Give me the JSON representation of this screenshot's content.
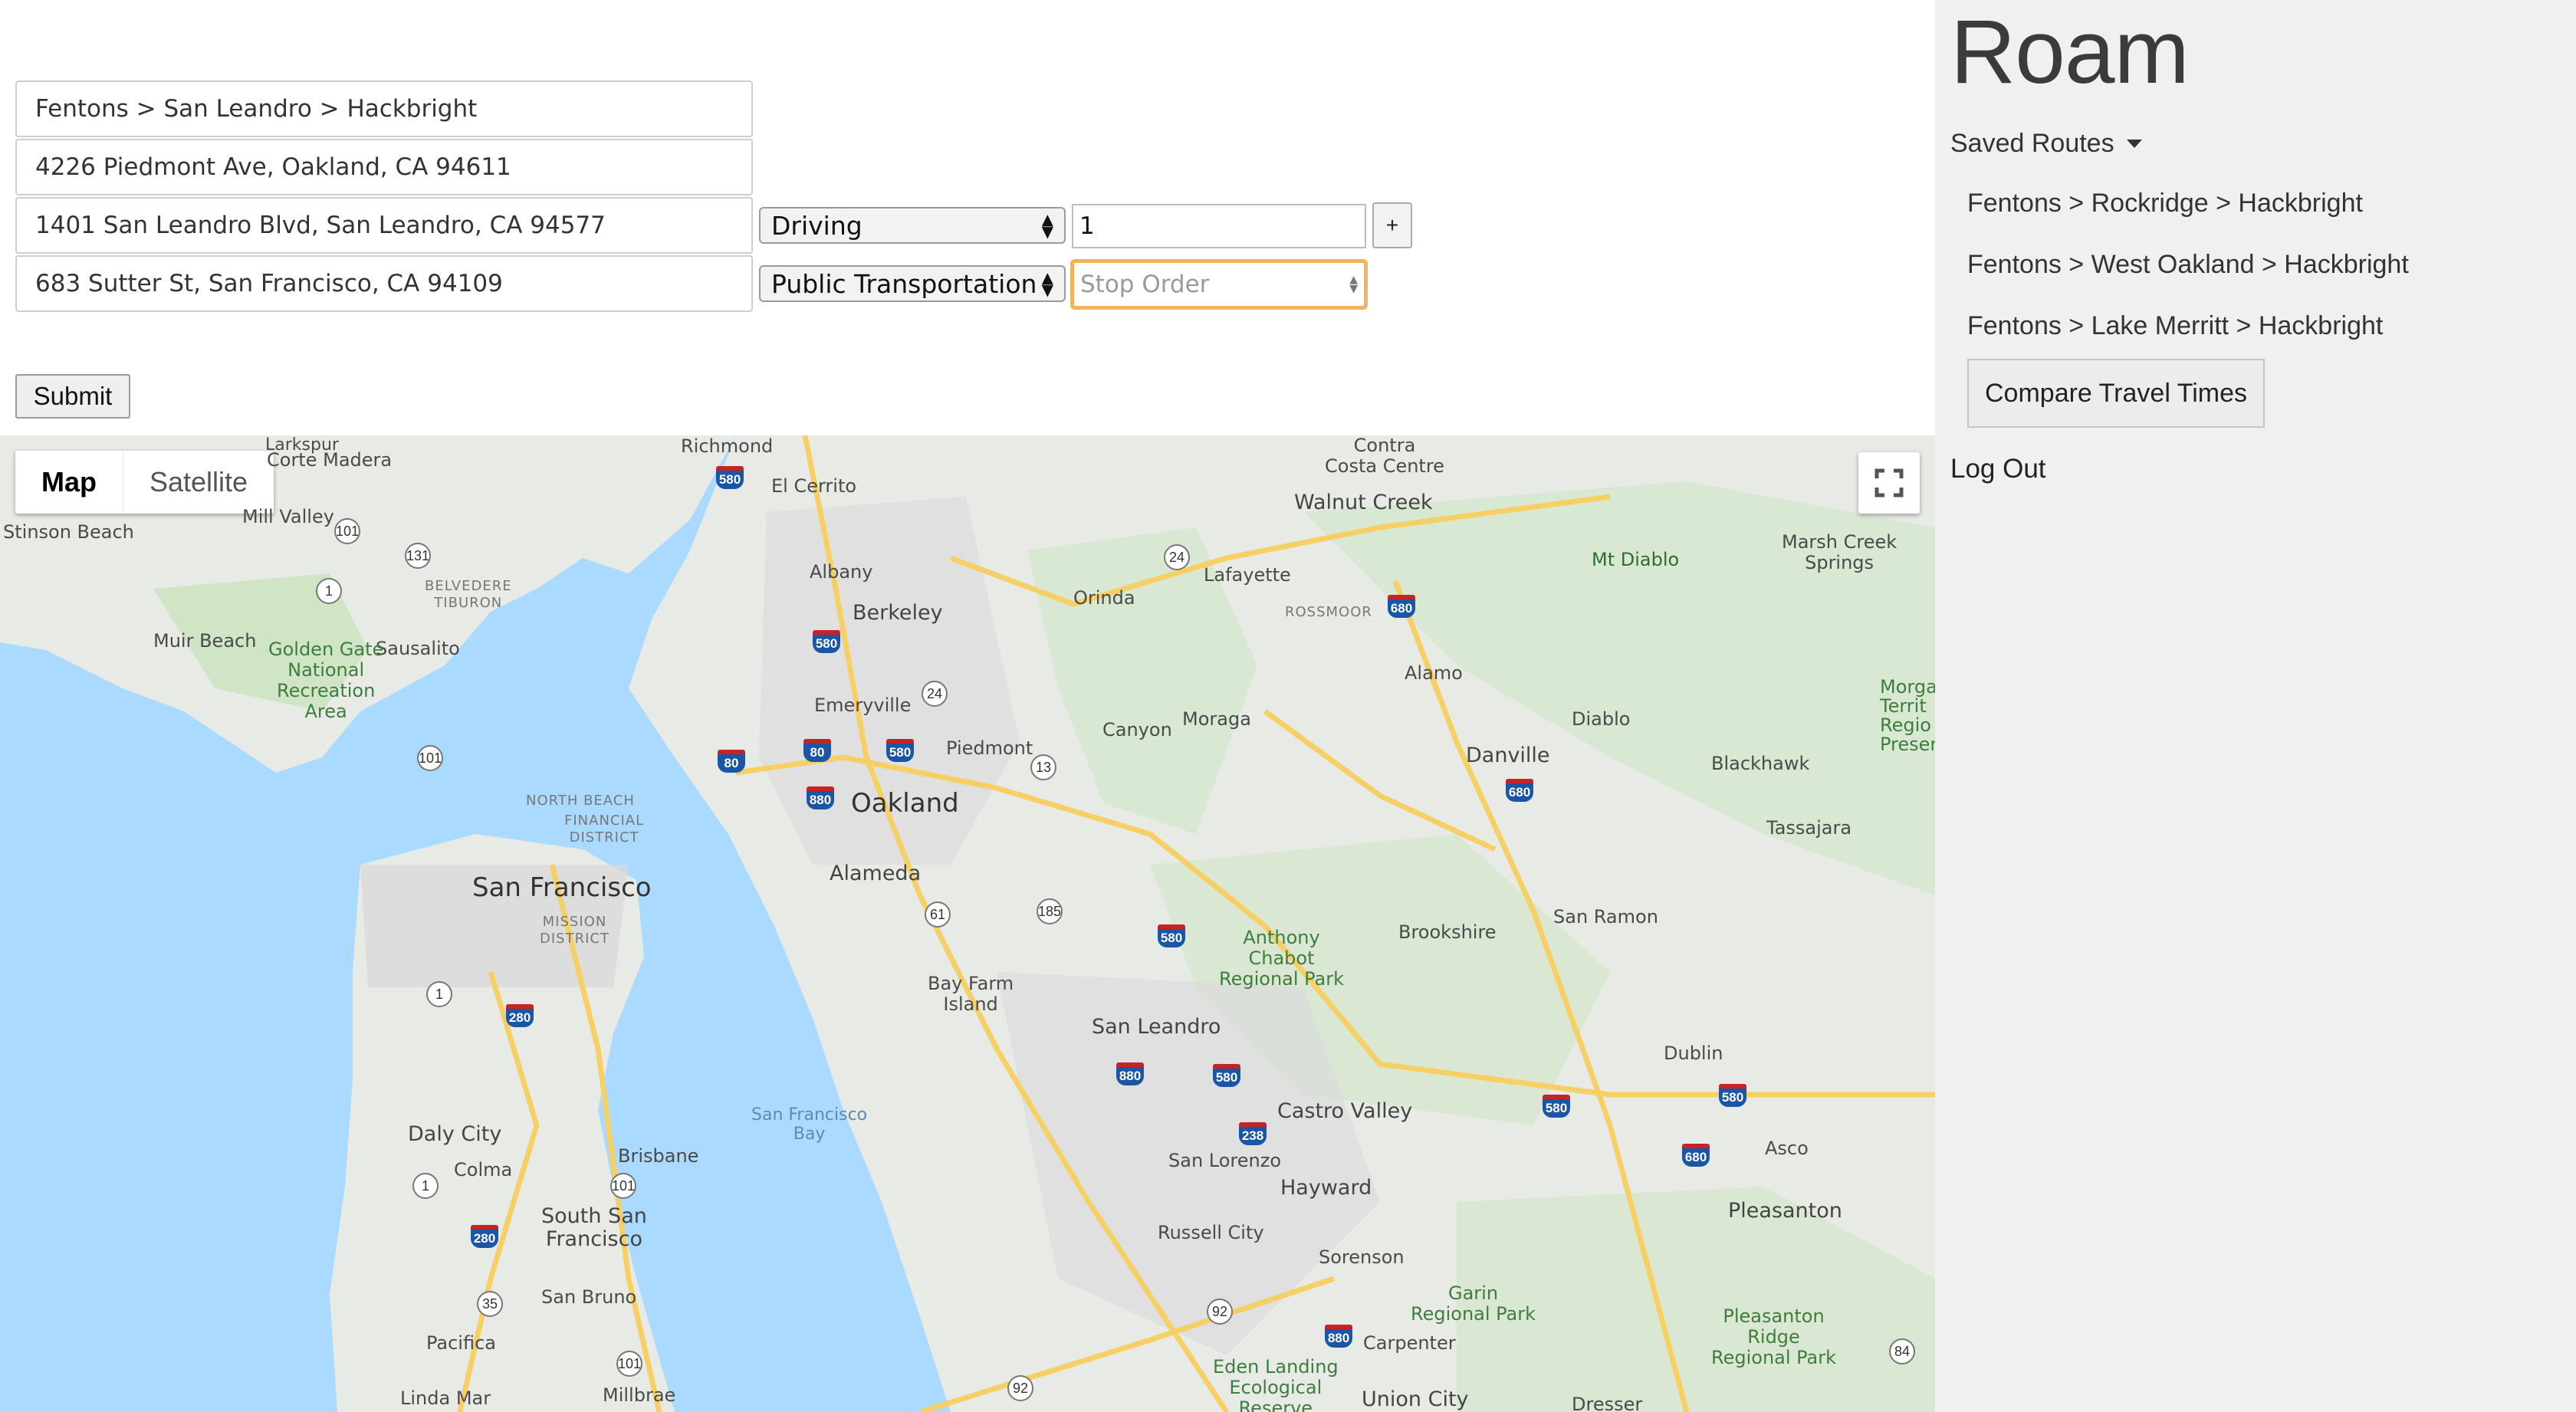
{
  "form": {
    "route_name": "Fentons > San Leandro > Hackbright",
    "stops": [
      {
        "address": "4226 Piedmont Ave, Oakland, CA 94611"
      },
      {
        "address": "1401 San Leandro Blvd, San Leandro, CA 94577",
        "mode": "Driving",
        "order": "1"
      },
      {
        "address": "683 Sutter St, San Francisco, CA 94109",
        "mode": "Public Transportation",
        "order_placeholder": "Stop Order"
      }
    ],
    "add_label": "+",
    "submit_label": "Submit"
  },
  "sidebar": {
    "brand": "Roam",
    "saved_routes_label": "Saved Routes",
    "routes": [
      "Fentons > Rockridge > Hackbright",
      "Fentons > West Oakland > Hackbright",
      "Fentons > Lake Merritt > Hackbright"
    ],
    "compare_label": "Compare Travel Times",
    "logout_label": "Log Out"
  },
  "map": {
    "type_buttons": [
      "Map",
      "Satellite"
    ],
    "places": {
      "larkspur": "Larkspur",
      "richmond": "Richmond",
      "el_cerrito": "El Cerrito",
      "contra_costa": "Contra\nCosta Centre",
      "corte_madera": "Corte Madera",
      "mill_valley": "Mill Valley",
      "stinson_beach": "Stinson Beach",
      "walnut_creek": "Walnut Creek",
      "marsh_creek": "Marsh Creek\nSprings",
      "mt_diablo": "Mt Diablo",
      "albany": "Albany",
      "lafayette": "Lafayette",
      "orinda": "Orinda",
      "berkeley": "Berkeley",
      "rossmoor": "ROSSMOOR",
      "belvedere": "BELVEDERE\nTIBURON",
      "muir_beach": "Muir Beach",
      "sausalito": "Sausalito",
      "ggnra": "Golden Gate\nNational\nRecreation\nArea",
      "alamo": "Alamo",
      "emeryville": "Emeryville",
      "piedmont": "Piedmont",
      "canyon": "Canyon",
      "moraga": "Moraga",
      "diablo": "Diablo",
      "morgan": "Morga\nTerrit\nRegio\nPreser",
      "danville": "Danville",
      "blackhawk": "Blackhawk",
      "oakland": "Oakland",
      "north_beach": "NORTH BEACH",
      "financial": "FINANCIAL\nDISTRICT",
      "tassajara": "Tassajara",
      "alameda": "Alameda",
      "san_francisco": "San Francisco",
      "mission": "MISSION\nDISTRICT",
      "san_ramon": "San Ramon",
      "brookshire": "Brookshire",
      "anthony_chabot": "Anthony\nChabot\nRegional Park",
      "bay_farm": "Bay Farm\nIsland",
      "san_leandro": "San Leandro",
      "dublin": "Dublin",
      "sf_bay": "San Francisco\nBay",
      "daly_city": "Daly City",
      "castro_valley": "Castro Valley",
      "colma": "Colma",
      "brisbane": "Brisbane",
      "san_lorenzo": "San Lorenzo",
      "asco": "Asco",
      "hayward": "Hayward",
      "south_sf": "South San\nFrancisco",
      "pleasanton": "Pleasanton",
      "russell_city": "Russell City",
      "sorenson": "Sorenson",
      "san_bruno": "San Bruno",
      "garin": "Garin\nRegional Park",
      "pleasanton_ridge": "Pleasanton\nRidge\nRegional Park",
      "pacifica": "Pacifica",
      "carpenter": "Carpenter",
      "eden_landing": "Eden Landing\nEcological\nReserve",
      "linda_mar": "Linda Mar",
      "millbrae": "Millbrae",
      "union_city": "Union City",
      "dresser": "Dresser"
    },
    "shields": {
      "i580_a": "580",
      "i580_b": "580",
      "i580_c": "580",
      "i580_d": "580",
      "i580_e": "580",
      "i580_f": "580",
      "i80_a": "80",
      "i80_b": "80",
      "i880_a": "880",
      "i880_b": "880",
      "i880_c": "880",
      "i680_a": "680",
      "i680_b": "680",
      "i680_c": "680",
      "i280_a": "280",
      "i280_b": "280",
      "i238": "238"
    },
    "routes": {
      "r131": "131",
      "r1_a": "1",
      "r101_a": "101",
      "r101_b": "101",
      "r24_a": "24",
      "r24_b": "24",
      "r13": "13",
      "r61": "61",
      "r185": "185",
      "r1_b": "1",
      "r1_c": "1",
      "r101_c": "101",
      "r35": "35",
      "r101_d": "101",
      "r92_a": "92",
      "r92_b": "92",
      "r84": "84"
    }
  }
}
